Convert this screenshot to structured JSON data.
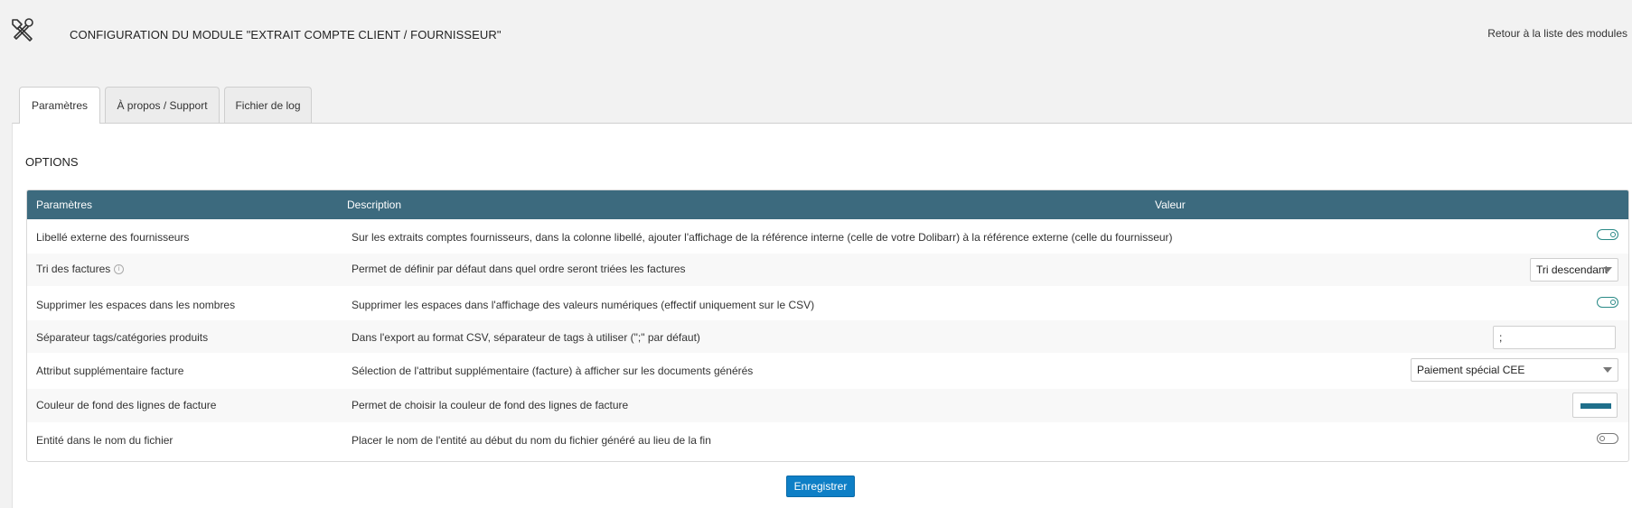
{
  "header": {
    "title": "CONFIGURATION DU MODULE \"EXTRAIT COMPTE CLIENT / FOURNISSEUR\"",
    "back_link": "Retour à la liste des modules",
    "icon": "tools-icon"
  },
  "tabs": [
    {
      "label": "Paramètres",
      "active": true
    },
    {
      "label": "À propos / Support",
      "active": false
    },
    {
      "label": "Fichier de log",
      "active": false
    }
  ],
  "section": {
    "title": "OPTIONS"
  },
  "table": {
    "headers": {
      "param": "Paramètres",
      "description": "Description",
      "value": "Valeur"
    },
    "header_color": "#3c6a7e",
    "rows": [
      {
        "param": "Libellé externe des fournisseurs",
        "description": "Sur les extraits comptes fournisseurs, dans la colonne libellé, ajouter l'affichage de la référence interne (celle de votre Dolibarr) à la référence externe (celle du fournisseur)",
        "value_type": "toggle",
        "toggle_on": true
      },
      {
        "param": "Tri des factures",
        "has_info_icon": true,
        "description": "Permet de définir par défaut dans quel ordre seront triées les factures",
        "value_type": "select",
        "value": "Tri descendant"
      },
      {
        "param": "Supprimer les espaces dans les nombres",
        "description": "Supprimer les espaces dans l'affichage des valeurs numériques (effectif uniquement sur le CSV)",
        "value_type": "toggle",
        "toggle_on": true
      },
      {
        "param": "Séparateur tags/catégories produits",
        "description": "Dans l'export au format CSV, séparateur de tags à utiliser (\";\" par défaut)",
        "value_type": "text",
        "value": ";"
      },
      {
        "param": "Attribut supplémentaire facture",
        "description": "Sélection de l'attribut supplémentaire (facture) à afficher sur les documents générés",
        "value_type": "select",
        "value": "Paiement spécial CEE"
      },
      {
        "param": "Couleur de fond des lignes de facture",
        "description": "Permet de choisir la couleur de fond des lignes de facture",
        "value_type": "color",
        "color": "#1f6f8b"
      },
      {
        "param": "Entité dans le nom du fichier",
        "description": "Placer le nom de l'entité au début du nom du fichier généré au lieu de la fin",
        "value_type": "toggle",
        "toggle_on": false
      }
    ]
  },
  "actions": {
    "save_label": "Enregistrer"
  },
  "colors": {
    "accent": "#0e7fc6",
    "toggle_on": "#2a8a87"
  }
}
